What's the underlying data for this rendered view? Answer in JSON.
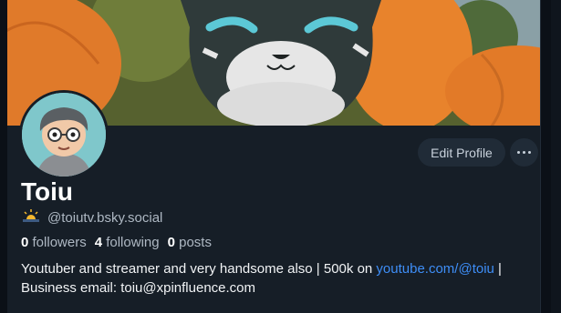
{
  "profile": {
    "display_name": "Toiu",
    "handle": "@toiutv.bsky.social",
    "handle_emoji": "sunrise-emoji-icon",
    "followers_count": "0",
    "followers_label": "followers",
    "following_count": "4",
    "following_label": "following",
    "posts_count": "0",
    "posts_label": "posts",
    "bio_part1": "Youtuber and streamer and very handsome also | 500k on ",
    "bio_link": "youtube.com/@toiu",
    "bio_part2": " |",
    "bio_line2": "Business email: toiu@xpinfluence.com"
  },
  "actions": {
    "edit_profile_label": "Edit Profile",
    "more_icon": "ellipsis-icon"
  },
  "colors": {
    "background": "#161e27",
    "button_bg": "#202b37",
    "link": "#3e8ef7",
    "muted_text": "#aeb8c3"
  }
}
